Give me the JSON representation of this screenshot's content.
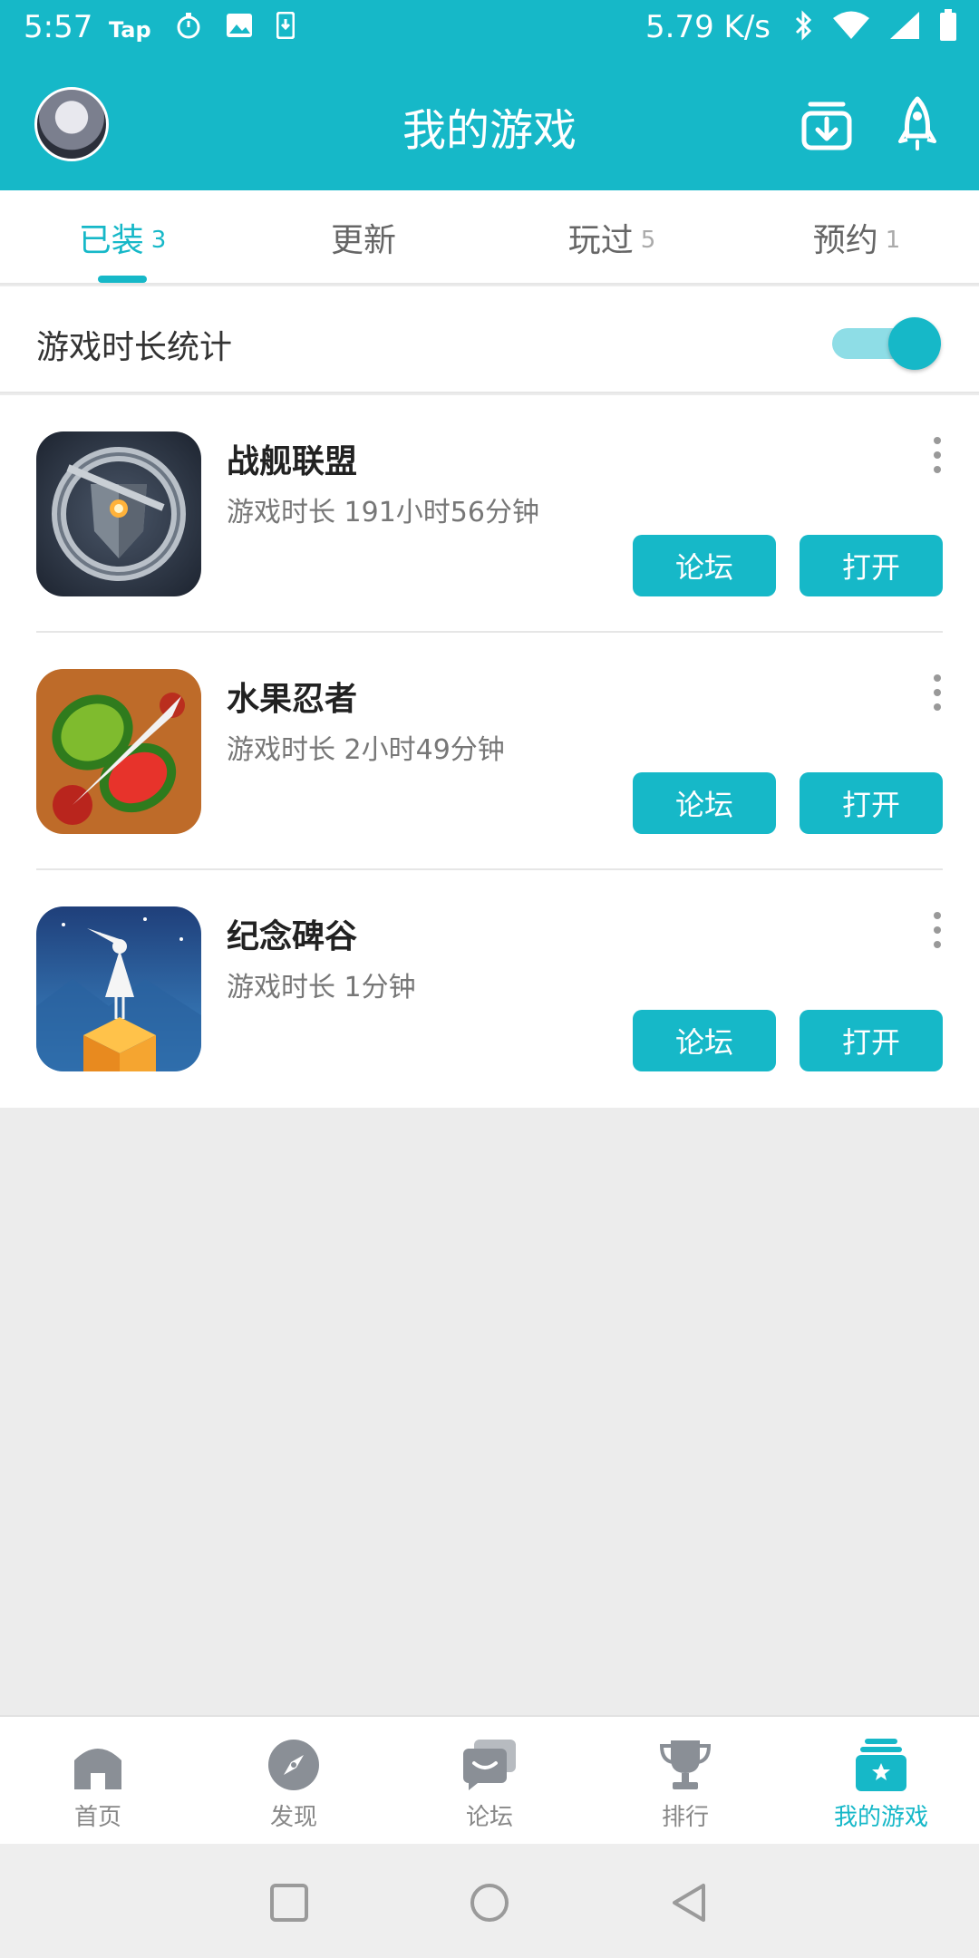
{
  "status_bar": {
    "time": "5:57",
    "left_icons": [
      "tap-app-icon",
      "stopwatch-icon",
      "image-icon",
      "download-phone-icon"
    ],
    "tap_label": "Tap",
    "net_speed": "5.79 K/s",
    "right_icons": [
      "bluetooth-icon",
      "wifi-icon",
      "signal-icon",
      "battery-icon"
    ]
  },
  "header": {
    "title": "我的游戏",
    "avatar": "user-avatar",
    "actions": [
      "download-manager-icon",
      "rocket-icon"
    ]
  },
  "tabs": [
    {
      "label": "已装",
      "count": "3",
      "active": true
    },
    {
      "label": "更新",
      "count": "",
      "active": false
    },
    {
      "label": "玩过",
      "count": "5",
      "active": false
    },
    {
      "label": "预约",
      "count": "1",
      "active": false
    }
  ],
  "stats": {
    "label": "游戏时长统计",
    "toggle_on": true
  },
  "games": [
    {
      "name": "战舰联盟",
      "playtime": "游戏时长 191小时56分钟",
      "forum_label": "论坛",
      "open_label": "打开",
      "icon": "warship-alliance-icon"
    },
    {
      "name": "水果忍者",
      "playtime": "游戏时长 2小时49分钟",
      "forum_label": "论坛",
      "open_label": "打开",
      "icon": "fruit-ninja-icon"
    },
    {
      "name": "纪念碑谷",
      "playtime": "游戏时长 1分钟",
      "forum_label": "论坛",
      "open_label": "打开",
      "icon": "monument-valley-icon"
    }
  ],
  "bottom_nav": [
    {
      "label": "首页",
      "icon": "home-icon",
      "active": false
    },
    {
      "label": "发现",
      "icon": "compass-icon",
      "active": false
    },
    {
      "label": "论坛",
      "icon": "forum-icon",
      "active": false
    },
    {
      "label": "排行",
      "icon": "trophy-icon",
      "active": false
    },
    {
      "label": "我的游戏",
      "icon": "my-games-icon",
      "active": true
    }
  ],
  "system_nav": [
    "recents-icon",
    "home-circle-icon",
    "back-icon"
  ],
  "colors": {
    "accent": "#16b8c8",
    "background": "#ececec",
    "text_primary": "#222222",
    "text_secondary": "#777777"
  }
}
